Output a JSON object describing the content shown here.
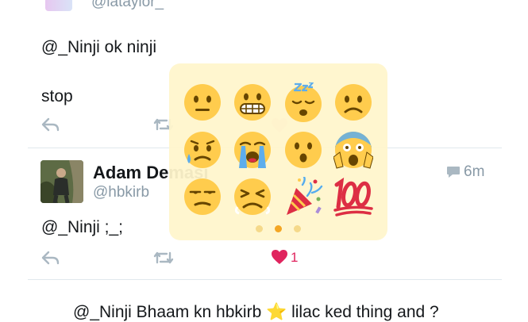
{
  "top_tweet": {
    "partial_handle": "@lataylor_",
    "text_line1": "@_Ninji ok ninji",
    "text_line2": "stop"
  },
  "tweet": {
    "name": "Adam Demasi",
    "handle": "@hbkirb",
    "time": "6m",
    "text": "@_Ninji ;_;",
    "like_count": "1"
  },
  "bottom_partial_text": "@_Ninji Bhaam kn hbkirb ⭐ lilac ked thing and ?",
  "emoji_picker": {
    "emojis": [
      "neutral-face",
      "grimacing-face",
      "sleeping-face",
      "frowning-face",
      "sad-relieved-face",
      "loudly-crying-face",
      "hushed-face",
      "screaming-face",
      "unamused-face",
      "persevering-face",
      "party-popper",
      "hundred-points"
    ],
    "active_page": 2,
    "page_count": 3
  },
  "colors": {
    "accent_like": "#e0245e",
    "icon_gray": "#aab8c2",
    "picker_bg": "#fff5cc",
    "emoji_yellow": "#ffcc4d"
  }
}
